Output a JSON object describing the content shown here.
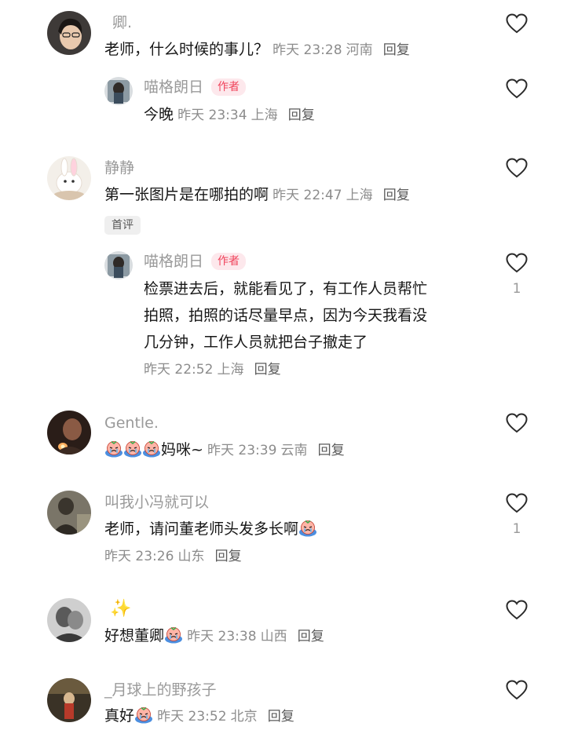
{
  "colors": {
    "author_badge_bg": "#fde8ec",
    "author_badge_text": "#f0445c",
    "meta": "#8c8c8c"
  },
  "comments": [
    {
      "user": "卿.",
      "text": "老师，什么时候的事儿？",
      "time": "昨天 23:28",
      "location": "河南",
      "reply_label": "回复",
      "icon": "heart-outline-icon"
    },
    {
      "user": "喵格朗日",
      "author_badge": "作者",
      "text": "今晚",
      "time": "昨天 23:34",
      "location": "上海",
      "reply_label": "回复"
    },
    {
      "user": "静静",
      "text": "第一张图片是在哪拍的啊",
      "time": "昨天 22:47",
      "location": "上海",
      "reply_label": "回复",
      "tag": "首评"
    },
    {
      "user": "喵格朗日",
      "author_badge": "作者",
      "text_lines": [
        "检票进去后，就能看见了，有工作人员帮忙",
        "拍照，拍照的话尽量早点，因为今天我看没",
        "几分钟，工作人员就把台子撤走了"
      ],
      "time": "昨天 22:52",
      "location": "上海",
      "reply_label": "回复",
      "likes": "1"
    },
    {
      "user": "Gentle.",
      "text": "妈咪~",
      "time": "昨天 23:39",
      "location": "云南",
      "reply_label": "回复"
    },
    {
      "user": "叫我小冯就可以",
      "text": "老师，请问董老师头发多长啊",
      "time": "昨天 23:26",
      "location": "山东",
      "reply_label": "回复",
      "likes": "1"
    },
    {
      "user": "✨",
      "text": "好想董卿",
      "time": "昨天 23:38",
      "location": "山西",
      "reply_label": "回复"
    },
    {
      "user": "_月球上的野孩子",
      "text": "真好",
      "time": "昨天 23:52",
      "location": "北京",
      "reply_label": "回复"
    }
  ]
}
